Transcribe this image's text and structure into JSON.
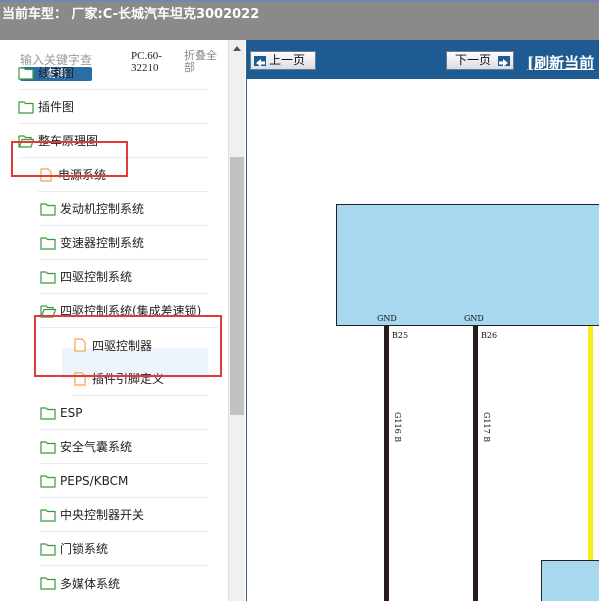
{
  "header": {
    "title": "当前车型： 厂家:C-长城汽车坦克3002022"
  },
  "search": {
    "placeholder": "输入关键字查",
    "button_label": "查询"
  },
  "model_code": "PC.60-32210",
  "collapse_label": "折叠全部",
  "tree": [
    {
      "label": "线束图",
      "icon": "folder-icon"
    },
    {
      "label": "插件图",
      "icon": "folder-icon"
    },
    {
      "label": "整车原理图",
      "icon": "folder-open-icon"
    },
    {
      "label": "电源系统",
      "icon": "file-icon"
    },
    {
      "label": "发动机控制系统",
      "icon": "folder-icon"
    },
    {
      "label": "变速器控制系统",
      "icon": "folder-icon"
    },
    {
      "label": "四驱控制系统",
      "icon": "folder-icon"
    },
    {
      "label": "四驱控制系统(集成差速锁)",
      "icon": "folder-open-icon"
    },
    {
      "label": "四驱控制器",
      "icon": "file-icon"
    },
    {
      "label": "插件引脚定义",
      "icon": "file-icon"
    },
    {
      "label": "ESP",
      "icon": "folder-icon"
    },
    {
      "label": "安全气囊系统",
      "icon": "folder-icon"
    },
    {
      "label": "PEPS/KBCM",
      "icon": "folder-icon"
    },
    {
      "label": "中央控制器开关",
      "icon": "folder-icon"
    },
    {
      "label": "门锁系统",
      "icon": "folder-icon"
    },
    {
      "label": "多媒体系统",
      "icon": "folder-icon"
    }
  ],
  "viewer": {
    "prev_label": "上一页",
    "next_label": "下一页",
    "refresh_label": "[刷新当前"
  },
  "schematic": {
    "gnd1": "GND",
    "gnd2": "GND",
    "pin1": "B25",
    "pin2": "B26",
    "wire1": "G116 B",
    "wire2": "G117 B"
  },
  "colors": {
    "header_bg": "#8a8a8a",
    "toolbar_bg": "#1f5b93",
    "module_fill": "#a8d8f0",
    "highlight_box": "#e03a3a",
    "wire_black": "#2a1c1c",
    "wire_yellow": "#f5ee1a"
  }
}
